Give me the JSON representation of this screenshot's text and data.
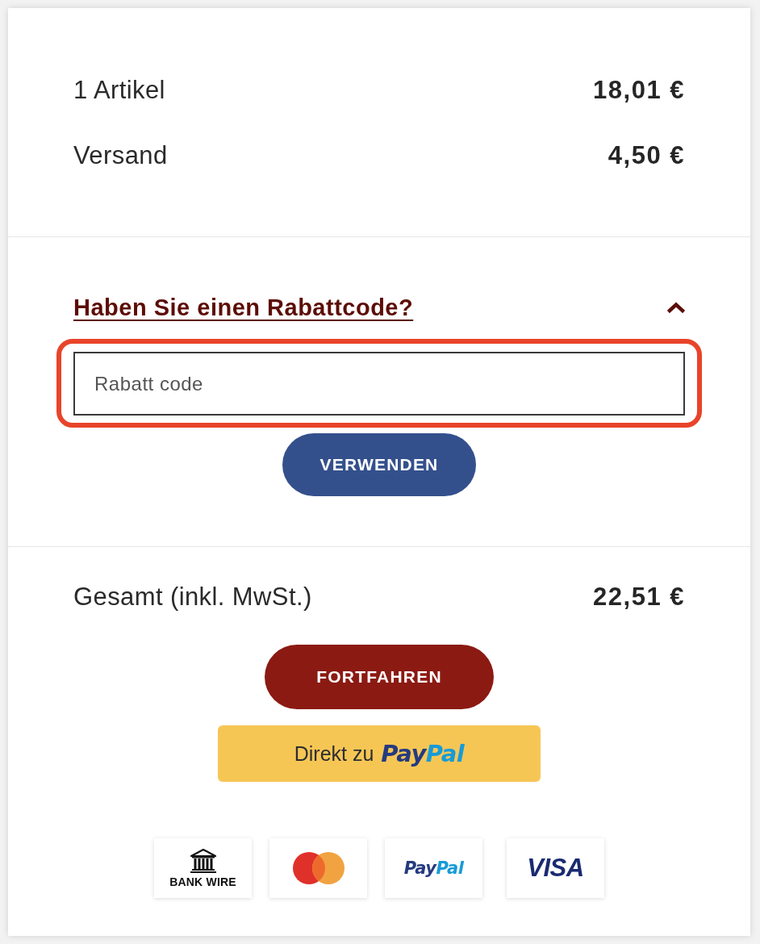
{
  "summary": {
    "rows": [
      {
        "label": "1 Artikel",
        "amount": "18,01 €"
      },
      {
        "label": "Versand",
        "amount": "4,50 €"
      }
    ]
  },
  "discount": {
    "toggle_label": "Haben Sie einen Rabattcode?",
    "expanded": true,
    "highlighted": true,
    "placeholder": "Rabatt code",
    "apply_button": "VERWENDEN"
  },
  "total": {
    "label": "Gesamt (inkl. MwSt.)",
    "amount": "22,51 €"
  },
  "continue_button": "FORTFAHREN",
  "paypal_button": {
    "label": "Direkt zu",
    "logo_parts": [
      "Pay",
      "Pal"
    ]
  },
  "payment_methods": [
    {
      "kind": "bank",
      "label": "BANK WIRE"
    },
    {
      "kind": "mastercard"
    },
    {
      "kind": "paypal",
      "logo_parts": [
        "Pay",
        "Pal"
      ]
    },
    {
      "kind": "visa",
      "label": "VISA"
    }
  ]
}
